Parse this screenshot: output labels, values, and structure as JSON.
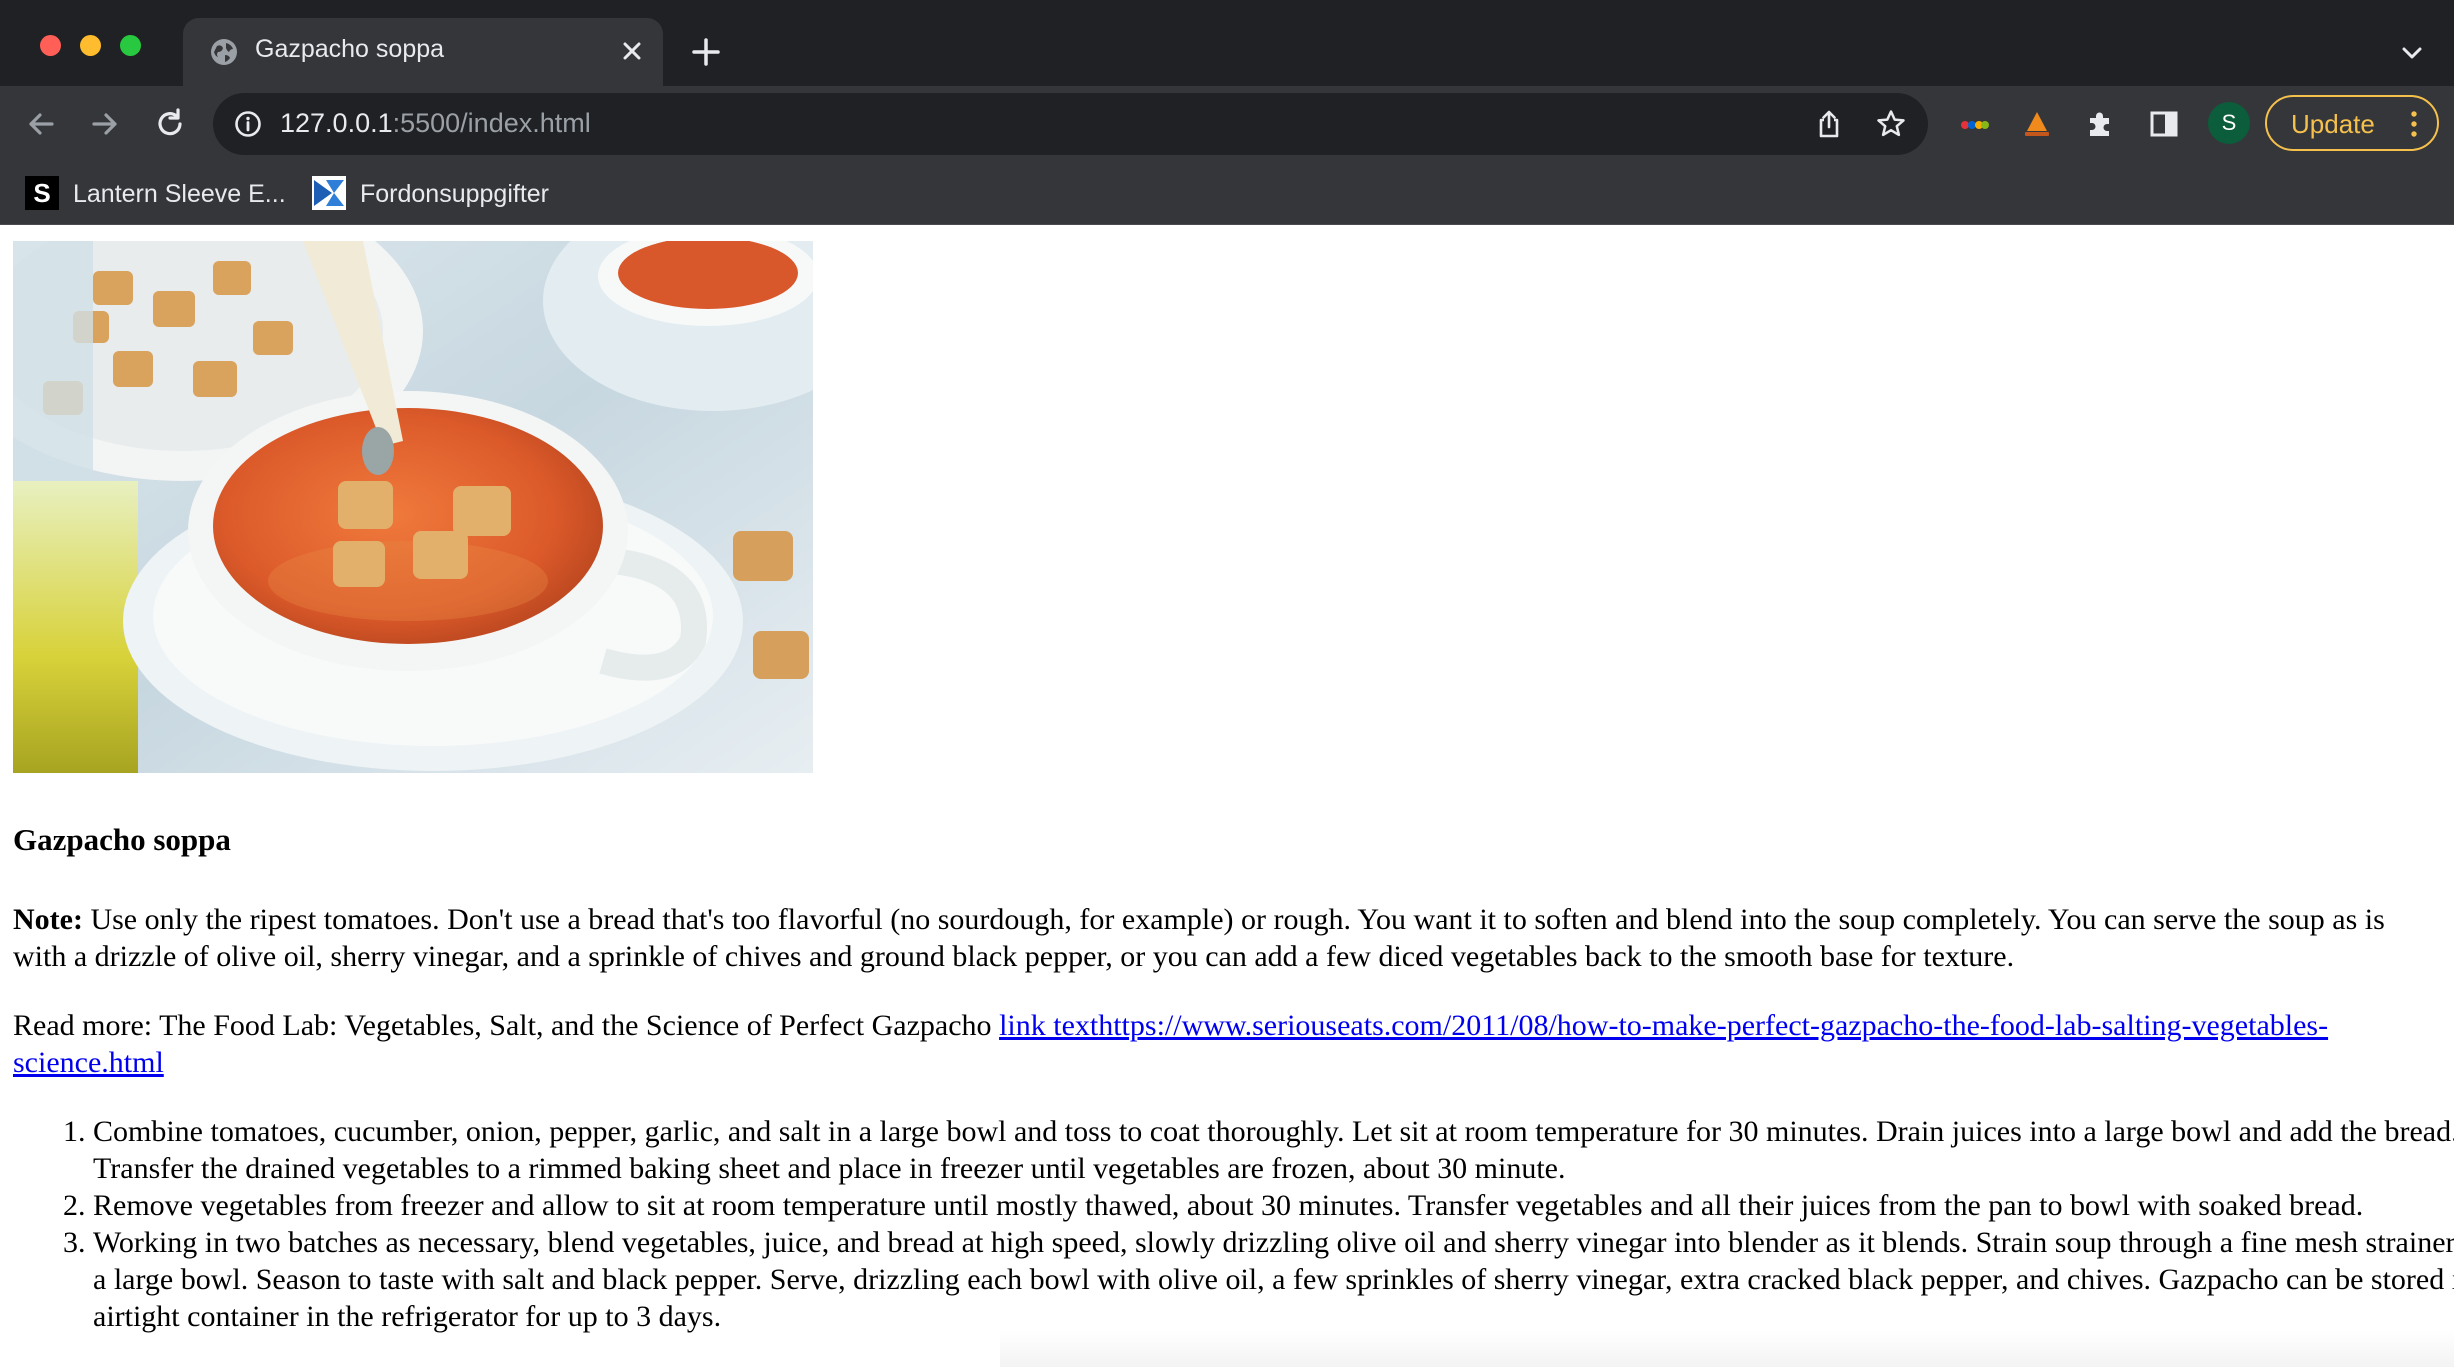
{
  "browser": {
    "tab": {
      "title": "Gazpacho soppa"
    },
    "address": {
      "host": "127.0.0.1",
      "path": ":5500/index.html"
    },
    "profile_initial": "S",
    "update_label": "Update",
    "bookmarks": [
      {
        "label": "Lantern Sleeve E...",
        "icon": "s-logo-icon"
      },
      {
        "label": "Fordonsuppgifter",
        "icon": "transportstyrelsen-icon"
      }
    ],
    "extensions": [
      "ebay-extension-icon",
      "honey-extension-icon",
      "puzzle-extensions-icon",
      "side-panel-icon"
    ]
  },
  "page": {
    "image_alt": "Gazpacho soup in a white bowl with croutons",
    "heading": "Gazpacho soppa",
    "note_label": "Note:",
    "note_text": " Use only the ripest tomatoes. Don't use a bread that's too flavorful (no sourdough, for example) or rough. You want it to soften and blend into the soup completely. You can serve the soup as is with a drizzle of olive oil, sherry vinegar, and a sprinkle of chives and ground black pepper, or you can add a few diced vegetables back to the smooth base for texture.",
    "readmore_text": "Read more: The Food Lab: Vegetables, Salt, and the Science of Perfect Gazpacho ",
    "readmore_link": "link texthttps://www.seriouseats.com/2011/08/how-to-make-perfect-gazpacho-the-food-lab-salting-vegetables-science.html",
    "steps": [
      "Combine tomatoes, cucumber, onion, pepper, garlic, and salt in a large bowl and toss to coat thoroughly. Let sit at room temperature for 30 minutes. Drain juices into a large bowl and add the bread. Transfer the drained vegetables to a rimmed baking sheet and place in freezer until vegetables are frozen, about 30 minute.",
      "Remove vegetables from freezer and allow to sit at room temperature until mostly thawed, about 30 minutes. Transfer vegetables and all their juices from the pan to bowl with soaked bread.",
      "Working in two batches as necessary, blend vegetables, juice, and bread at high speed, slowly drizzling olive oil and sherry vinegar into blender as it blends. Strain soup through a fine mesh strainer into a large bowl. Season to taste with salt and black pepper. Serve, drizzling each bowl with olive oil, a few sprinkles of sherry vinegar, extra cracked black pepper, and chives. Gazpacho can be stored in an airtight container in the refrigerator for up to 3 days."
    ]
  }
}
